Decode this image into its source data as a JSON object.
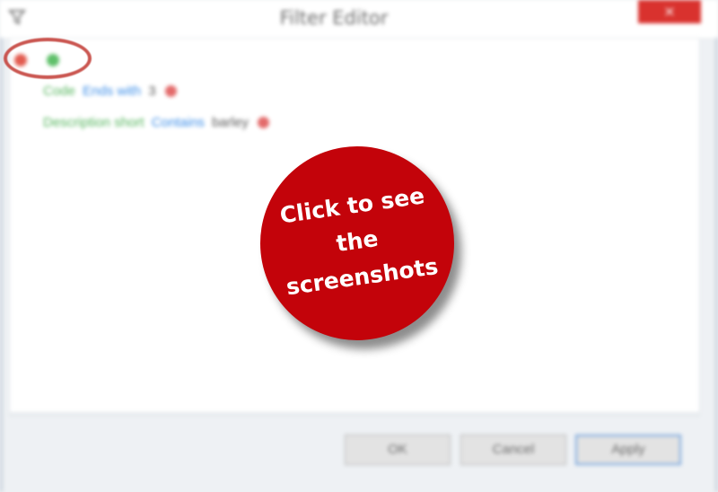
{
  "window": {
    "title": "Filter Editor",
    "close_label": "×"
  },
  "icons": {
    "app": "filter-icon",
    "group": "red-dot-icon",
    "add": "green-dot-icon",
    "remove": "remove-condition-icon"
  },
  "conditions": [
    {
      "field": "Code",
      "operator": "Ends with",
      "value": "3"
    },
    {
      "field": "Description short",
      "operator": "Contains",
      "value": "barley"
    }
  ],
  "buttons": {
    "ok": "OK",
    "cancel": "Cancel",
    "apply": "Apply"
  },
  "overlay": {
    "line1": "Click to see the",
    "line2": "screenshots"
  },
  "colors": {
    "field": "#55b55d",
    "operator": "#3d8ee8",
    "overlay": "#c3030a",
    "close": "#d9322e"
  }
}
